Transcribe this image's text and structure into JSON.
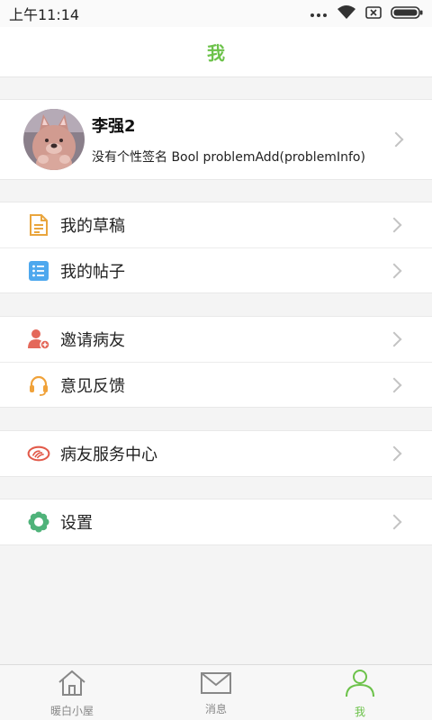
{
  "status_bar": {
    "time": "上午11:14",
    "icons": [
      "signal-dots-icon",
      "wifi-icon",
      "sim-icon",
      "battery-icon"
    ]
  },
  "header": {
    "title": "我"
  },
  "profile": {
    "name": "李强2",
    "signature": "没有个性签名 Bool problemAdd(problemInfo)",
    "avatar": "cartoon-bear-avatar"
  },
  "menu_groups": [
    {
      "items": [
        {
          "label": "我的草稿",
          "icon": "draft-doc-icon",
          "color": "#e9a53d"
        },
        {
          "label": "我的帖子",
          "icon": "post-list-icon",
          "color": "#4ea8ee"
        }
      ]
    },
    {
      "items": [
        {
          "label": "邀请病友",
          "icon": "invite-user-icon",
          "color": "#e4685a"
        },
        {
          "label": "意见反馈",
          "icon": "headset-icon",
          "color": "#f0a23a"
        }
      ]
    },
    {
      "items": [
        {
          "label": "病友服务中心",
          "icon": "handshake-icon",
          "color": "#e25a4a"
        }
      ]
    },
    {
      "items": [
        {
          "label": "设置",
          "icon": "settings-gear-icon",
          "color": "#4fb37a"
        }
      ]
    }
  ],
  "tab_bar": {
    "tabs": [
      {
        "label": "暖白小屋",
        "icon": "home-icon",
        "active": false
      },
      {
        "label": "消息",
        "icon": "mail-icon",
        "active": false
      },
      {
        "label": "我",
        "icon": "person-icon",
        "active": true
      }
    ],
    "active_color": "#6cc24a",
    "inactive_color": "#888888"
  }
}
